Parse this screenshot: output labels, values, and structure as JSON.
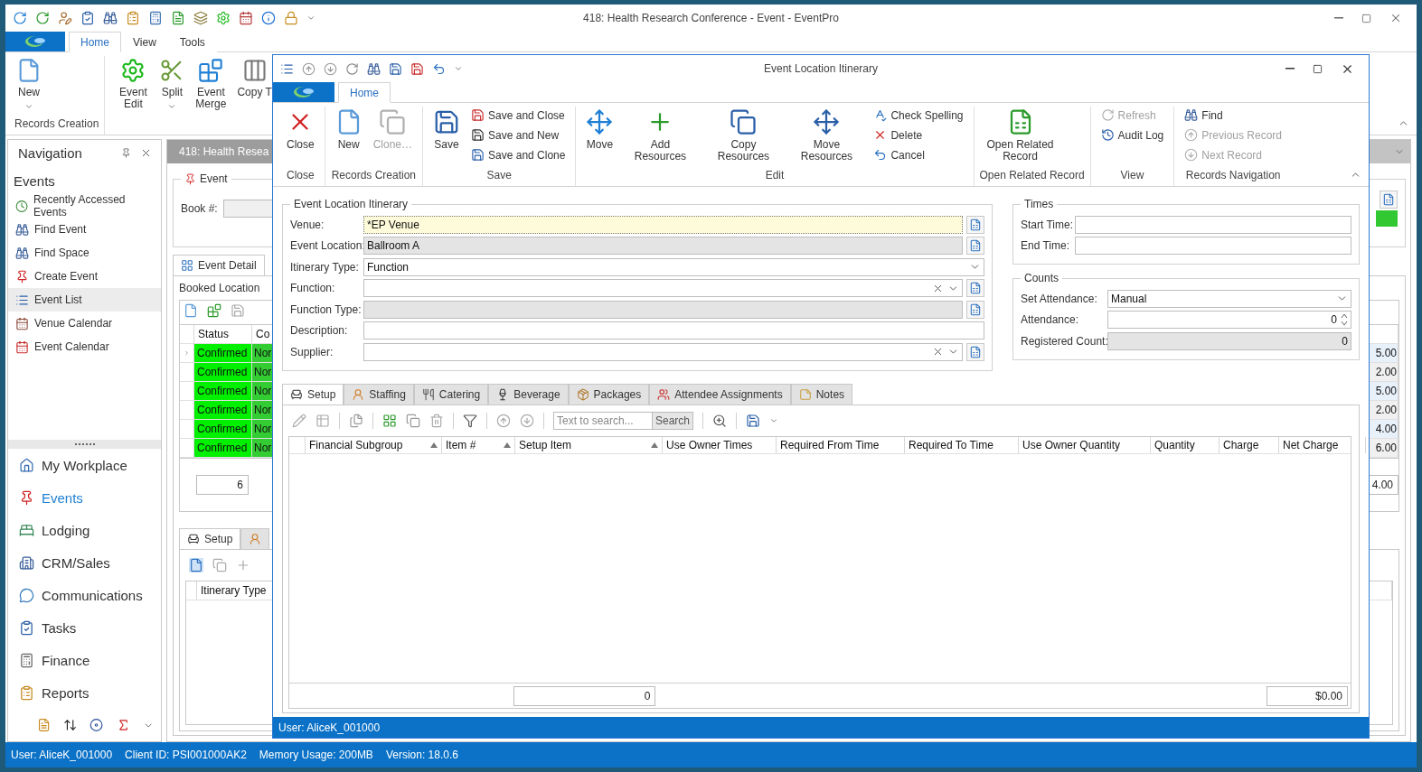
{
  "app": {
    "title": "418: Health Research Conference - Event - EventPro",
    "tabs": [
      {
        "label": "Home",
        "selected": true
      },
      {
        "label": "View",
        "selected": false
      },
      {
        "label": "Tools",
        "selected": false
      }
    ],
    "ribbon_groups": [
      {
        "label": "Records Creation",
        "buttons": [
          {
            "label": "New",
            "dropdown": true
          }
        ]
      },
      {
        "buttons": [
          {
            "label": "Event Edit",
            "dropdown": false
          },
          {
            "label": "Split",
            "dropdown": true
          },
          {
            "label": "Event Merge",
            "dropdown": false
          },
          {
            "label": "Copy T",
            "dropdown": false
          }
        ]
      }
    ]
  },
  "navigation": {
    "title": "Navigation",
    "section": "Events",
    "items": [
      {
        "label": "Recently Accessed Events",
        "selected": false
      },
      {
        "label": "Find Event",
        "selected": false
      },
      {
        "label": "Find Space",
        "selected": false
      },
      {
        "label": "Create Event",
        "selected": false
      },
      {
        "label": "Event List",
        "selected": true
      },
      {
        "label": "Venue Calendar",
        "selected": false
      },
      {
        "label": "Event Calendar",
        "selected": false
      }
    ],
    "modules": [
      {
        "label": "My Workplace",
        "selected": false
      },
      {
        "label": "Events",
        "selected": true
      },
      {
        "label": "Lodging",
        "selected": false
      },
      {
        "label": "CRM/Sales",
        "selected": false
      },
      {
        "label": "Communications",
        "selected": false
      },
      {
        "label": "Tasks",
        "selected": false
      },
      {
        "label": "Finance",
        "selected": false
      },
      {
        "label": "Reports",
        "selected": false
      }
    ]
  },
  "document": {
    "tab": "418: Health Resea",
    "event_group": "Event",
    "book_label": "Book #:",
    "tabs": [
      {
        "label": "Event Detail",
        "selected": true
      }
    ],
    "subtab": "Booked Location",
    "grid": {
      "columns": [
        "Status",
        "Co"
      ],
      "rows": [
        {
          "status": "Confirmed",
          "column_2": "Nor",
          "column_3": "5.00"
        },
        {
          "status": "Confirmed",
          "column_2": "Nor",
          "column_3": "2.00"
        },
        {
          "status": "Confirmed",
          "column_2": "Nor",
          "column_3": "5.00"
        },
        {
          "status": "Confirmed",
          "column_2": "Nor",
          "column_3": "2.00"
        },
        {
          "status": "Confirmed",
          "column_2": "Nor",
          "column_3": "4.00"
        },
        {
          "status": "Confirmed",
          "column_2": "Nor",
          "column_3": "6.00"
        }
      ],
      "count": "6",
      "total": "4.00"
    },
    "lower_tabs": [
      {
        "label": "Setup",
        "selected": true
      }
    ],
    "lower_grid_column": "Itinerary Type"
  },
  "dialog": {
    "title": "Event Location Itinerary",
    "tabs": [
      {
        "label": "Home",
        "selected": true
      }
    ],
    "ribbon_groups": [
      {
        "label": "Close",
        "buttons": [
          {
            "label": "Close",
            "kind": "large",
            "disabled": false
          }
        ]
      },
      {
        "label": "Records Creation",
        "buttons": [
          {
            "label": "New",
            "kind": "large",
            "disabled": false
          },
          {
            "label": "Clone…",
            "kind": "large",
            "disabled": true
          }
        ]
      },
      {
        "label": "Save",
        "buttons": [
          {
            "label": "Save",
            "kind": "large",
            "disabled": false
          },
          {
            "label": "Save and Close",
            "kind": "small",
            "disabled": false
          },
          {
            "label": "Save and New",
            "kind": "small",
            "disabled": false
          },
          {
            "label": "Save and Clone",
            "kind": "small",
            "disabled": false
          }
        ]
      },
      {
        "label": "Edit",
        "buttons": [
          {
            "label": "Move",
            "kind": "large",
            "disabled": false
          },
          {
            "label": "Add Resources",
            "kind": "large",
            "disabled": false
          },
          {
            "label": "Copy Resources",
            "kind": "large",
            "disabled": false
          },
          {
            "label": "Move Resources",
            "kind": "large",
            "disabled": false
          },
          {
            "label": "Check Spelling",
            "kind": "small",
            "disabled": false
          },
          {
            "label": "Delete",
            "kind": "small",
            "disabled": false
          },
          {
            "label": "Cancel",
            "kind": "small",
            "disabled": false
          }
        ]
      },
      {
        "label": "Open Related Record",
        "buttons": [
          {
            "label": "Open Related Record",
            "kind": "large",
            "disabled": false
          }
        ]
      },
      {
        "label": "View",
        "buttons": [
          {
            "label": "Refresh",
            "kind": "small",
            "disabled": true
          },
          {
            "label": "Audit Log",
            "kind": "small",
            "disabled": false
          }
        ]
      },
      {
        "label": "Records Navigation",
        "buttons": [
          {
            "label": "Find",
            "kind": "small",
            "disabled": false
          },
          {
            "label": "Previous Record",
            "kind": "small",
            "disabled": true
          },
          {
            "label": "Next Record",
            "kind": "small",
            "disabled": true
          }
        ]
      }
    ],
    "itinerary": {
      "title": "Event Location Itinerary",
      "fields": [
        {
          "label": "Venue:",
          "value": "*EP Venue",
          "kind": "lookup",
          "readonly": false,
          "focused": true
        },
        {
          "label": "Event Location:",
          "value": "Ballroom A",
          "kind": "lookup",
          "readonly": true,
          "focused": false
        },
        {
          "label": "Itinerary Type:",
          "value": "Function",
          "kind": "combo",
          "readonly": false,
          "focused": false
        },
        {
          "label": "Function:",
          "kind": "clear_lookup",
          "readonly": false,
          "focused": false
        },
        {
          "label": "Function Type:",
          "kind": "lookup",
          "readonly": true,
          "focused": false
        },
        {
          "label": "Description:",
          "readonly": false,
          "focused": false
        },
        {
          "label": "Supplier:",
          "kind": "clear_lookup",
          "readonly": false,
          "focused": false
        }
      ]
    },
    "times": {
      "title": "Times",
      "fields": [
        {
          "label": "Start Time:",
          "readonly": false,
          "focused": false
        },
        {
          "label": "End Time:",
          "readonly": false,
          "focused": false
        }
      ]
    },
    "counts": {
      "title": "Counts",
      "fields": [
        {
          "label": "Set Attendance:",
          "value": "Manual",
          "kind": "combo",
          "readonly": false,
          "focused": false
        },
        {
          "label": "Attendance:",
          "value": "0",
          "kind": "spin",
          "readonly": false,
          "focused": false
        },
        {
          "label": "Registered Count:",
          "value": "0",
          "kind": "number",
          "readonly": true,
          "focused": false
        }
      ]
    },
    "detail_tabs": [
      {
        "label": "Setup",
        "selected": true
      },
      {
        "label": "Staffing",
        "selected": false
      },
      {
        "label": "Catering",
        "selected": false
      },
      {
        "label": "Beverage",
        "selected": false
      },
      {
        "label": "Packages",
        "selected": false
      },
      {
        "label": "Attendee Assignments",
        "selected": false
      },
      {
        "label": "Notes",
        "selected": false
      }
    ],
    "search": {
      "placeholder": "Text to search...",
      "button": "Search"
    },
    "grid": {
      "columns": [
        {
          "label": "Financial Subgroup",
          "sorted": true
        },
        {
          "label": "Item #",
          "sorted": true
        },
        {
          "label": "Setup Item",
          "sorted": true,
          "total": "0"
        },
        {
          "label": "Use Owner Times",
          "sorted": false
        },
        {
          "label": "Required From Time",
          "sorted": false
        },
        {
          "label": "Required To Time",
          "sorted": false
        },
        {
          "label": "Use Owner Quantity",
          "sorted": false
        },
        {
          "label": "Quantity",
          "sorted": false
        },
        {
          "label": "Charge",
          "sorted": false
        },
        {
          "label": "Net Charge",
          "sorted": false,
          "total": "$0.00"
        }
      ]
    },
    "status_bar": "User: AliceK_001000"
  },
  "status_bar": [
    "User: AliceK_001000",
    "Client ID: PSI001000AK2",
    "Memory Usage: 200MB",
    "Version: 18.0.6"
  ]
}
